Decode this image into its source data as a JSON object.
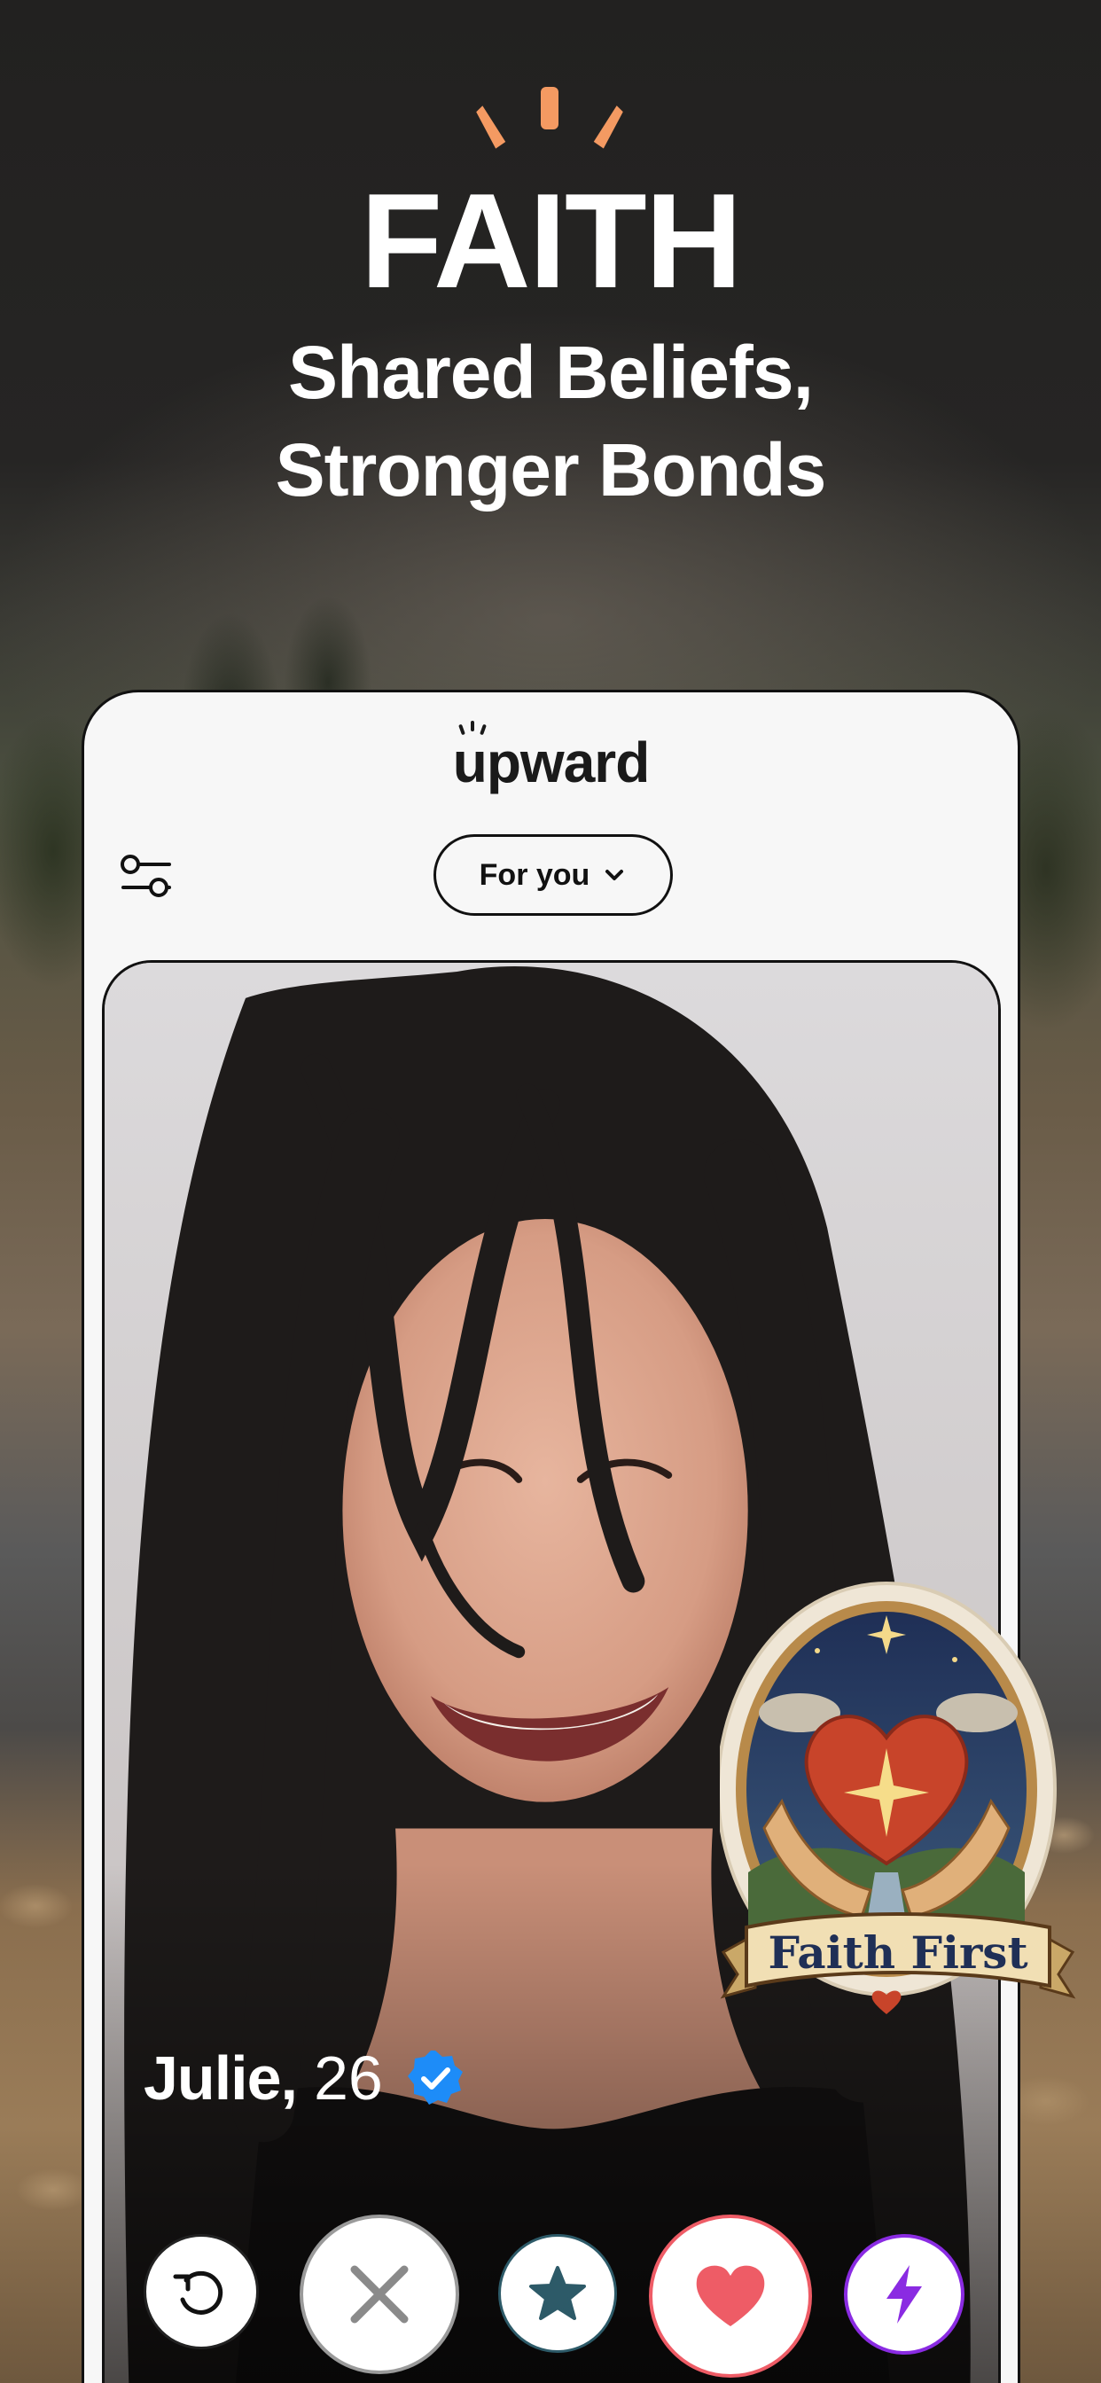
{
  "promo": {
    "headline": "FAITH",
    "subline_1": "Shared Beliefs,",
    "subline_2": "Stronger Bonds"
  },
  "app": {
    "brand": "upward",
    "feed_selector": "For you"
  },
  "profile": {
    "name": "Julie",
    "separator": ",",
    "age": "26",
    "verified": true
  },
  "actions": [
    {
      "id": "rewind",
      "icon": "undo-arrow-icon"
    },
    {
      "id": "nope",
      "icon": "x-icon"
    },
    {
      "id": "super_like",
      "icon": "star-icon"
    },
    {
      "id": "like",
      "icon": "heart-icon"
    },
    {
      "id": "boost",
      "icon": "lightning-icon"
    }
  ],
  "sticker": {
    "text": "Faith First"
  },
  "colors": {
    "accent_orange": "#f49a62",
    "verified_blue": "#1d8cf8",
    "like_red": "#ee5c66",
    "super_teal": "#2d5a68",
    "boost_purple": "#8a2be2"
  }
}
